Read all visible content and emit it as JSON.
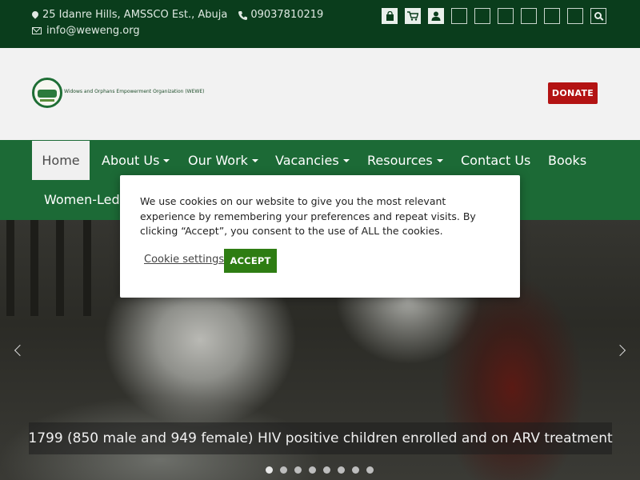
{
  "topbar": {
    "address": "25 Idanre Hills, AMSSCO Est., Abuja",
    "phone": "09037810219",
    "email": "info@weweng.org",
    "icons": [
      "map-marker-icon",
      "phone-icon",
      "envelope-icon",
      "shopping-bag-icon",
      "cart-icon",
      "user-icon",
      "search-icon"
    ]
  },
  "header": {
    "logo_text": "Widows and Orphans Empowerment Organization (WEWE)",
    "donate_label": "DONATE"
  },
  "nav": {
    "items": [
      {
        "label": "Home"
      },
      {
        "label": "About Us"
      },
      {
        "label": "Our Work"
      },
      {
        "label": "Vacancies"
      },
      {
        "label": "Resources"
      },
      {
        "label": "Contact Us"
      },
      {
        "label": "Books"
      },
      {
        "label": "Women-Led I"
      }
    ]
  },
  "hero": {
    "caption": "1799 (850 male and 949 female) HIV positive children enrolled and on ARV treatment"
  },
  "cookie": {
    "message": "We use cookies on our website to give you the most relevant experience by remembering your preferences and repeat visits. By clicking “Accept”, you consent to the use of ALL the cookies.",
    "settings_label": "Cookie settings",
    "accept_label": "ACCEPT"
  },
  "colors": {
    "topbar": "#0a3d1c",
    "nav": "#1c6a36",
    "donate": "#b31313",
    "accept": "#2e7d13"
  }
}
